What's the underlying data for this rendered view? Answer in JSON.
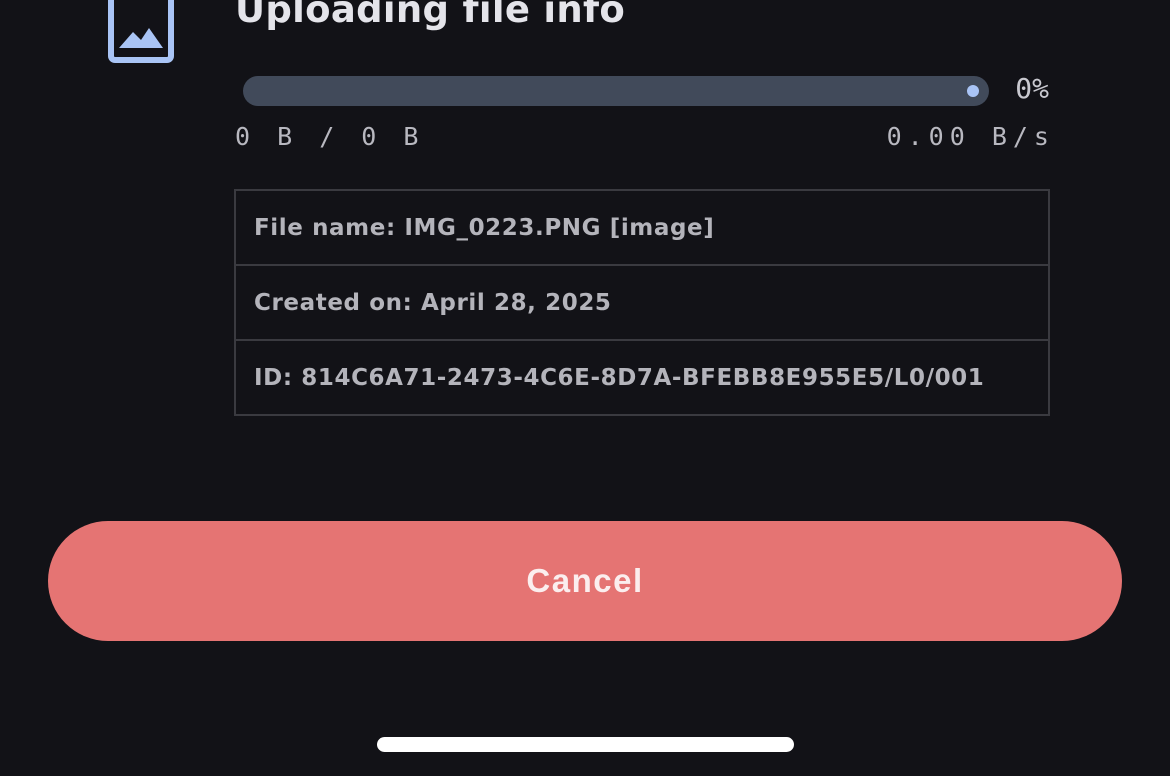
{
  "header": {
    "icon": "image-icon",
    "title": "Uploading file info"
  },
  "progress": {
    "fraction": 0,
    "percent_label": "0%",
    "transferred_label": "0 B / 0 B",
    "speed_label": "0.00 B/s"
  },
  "file_info": {
    "rows": [
      "File name: IMG_0223.PNG [image]",
      "Created on: April 28, 2025",
      "ID: 814C6A71-2473-4C6E-8D7A-BFEBB8E955E5/L0/001"
    ]
  },
  "actions": {
    "cancel_label": "Cancel"
  },
  "colors": {
    "background": "#121217",
    "accent": "#a9c4f5",
    "track": "#414a5a",
    "cancel": "#e57473"
  }
}
